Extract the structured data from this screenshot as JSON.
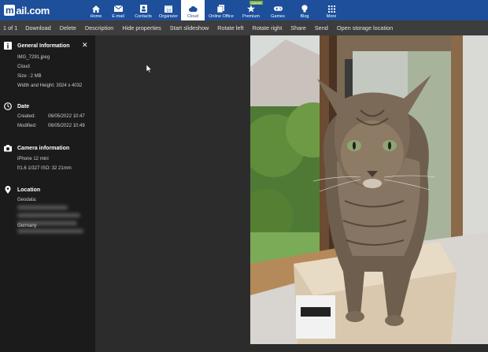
{
  "brand": {
    "name": "mail.com",
    "mark": "m"
  },
  "nav": [
    {
      "label": "Home",
      "icon": "home-icon"
    },
    {
      "label": "E-mail",
      "icon": "envelope-icon"
    },
    {
      "label": "Contacts",
      "icon": "contacts-icon"
    },
    {
      "label": "Organizer",
      "icon": "calendar-icon"
    },
    {
      "label": "Cloud",
      "icon": "cloud-icon",
      "active": true
    },
    {
      "label": "Online Office",
      "icon": "documents-icon"
    },
    {
      "label": "Premium",
      "icon": "star-icon",
      "badge": "Special"
    },
    {
      "label": "Games",
      "icon": "gamepad-icon"
    },
    {
      "label": "Blog",
      "icon": "lightbulb-icon"
    },
    {
      "label": "More",
      "icon": "grid-icon"
    }
  ],
  "toolbar": {
    "counter": "1 of 1",
    "download": "Download",
    "delete": "Delete",
    "description": "Description",
    "hide_properties": "Hide properties",
    "start_slideshow": "Start slideshow",
    "rotate_left": "Rotate left",
    "rotate_right": "Rotate right",
    "share": "Share",
    "send": "Send",
    "open_storage": "Open storage location"
  },
  "panel": {
    "general": {
      "title": "General Information",
      "filename": "IMG_7291.jpeg",
      "location": "Cloud",
      "size": "Size : 2 MB",
      "dimensions": "Width and Height: 3024 x 4032"
    },
    "date": {
      "title": "Date",
      "created_label": "Created:",
      "created_value": "06/05/2022 10:47",
      "modified_label": "Modified:",
      "modified_value": "06/05/2022 10:49"
    },
    "camera": {
      "title": "Camera information",
      "model": "iPhone 12 mini",
      "settings": "f/1.6 1/327 ISO: 32 21mm"
    },
    "location": {
      "title": "Location",
      "geodata_label": "Geodata:",
      "country": "Germany"
    }
  },
  "colors": {
    "nav_bg": "#1d4f9b",
    "toolbar_bg": "#3d3d3d",
    "panel_bg": "#1b1b1b",
    "main_bg": "#2c2c2c"
  }
}
